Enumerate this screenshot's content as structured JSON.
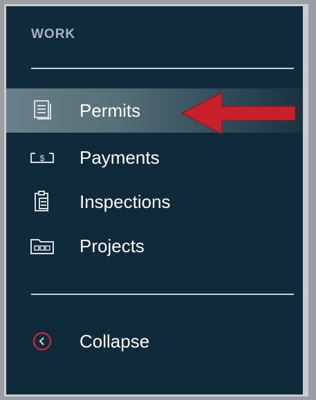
{
  "sidebar": {
    "section_title": "WORK",
    "items": [
      {
        "label": "Permits",
        "icon": "document-stack-icon",
        "active": true
      },
      {
        "label": "Payments",
        "icon": "cash-icon",
        "active": false
      },
      {
        "label": "Inspections",
        "icon": "clipboard-icon",
        "active": false
      },
      {
        "label": "Projects",
        "icon": "folder-icon",
        "active": false
      }
    ],
    "collapse": {
      "label": "Collapse",
      "icon": "chevron-left-circle-icon"
    }
  },
  "colors": {
    "panel_bg": "#0f2a3a",
    "active_highlight": "#587078",
    "annotation_arrow": "#c8202a",
    "collapse_icon": "#c5243a"
  }
}
